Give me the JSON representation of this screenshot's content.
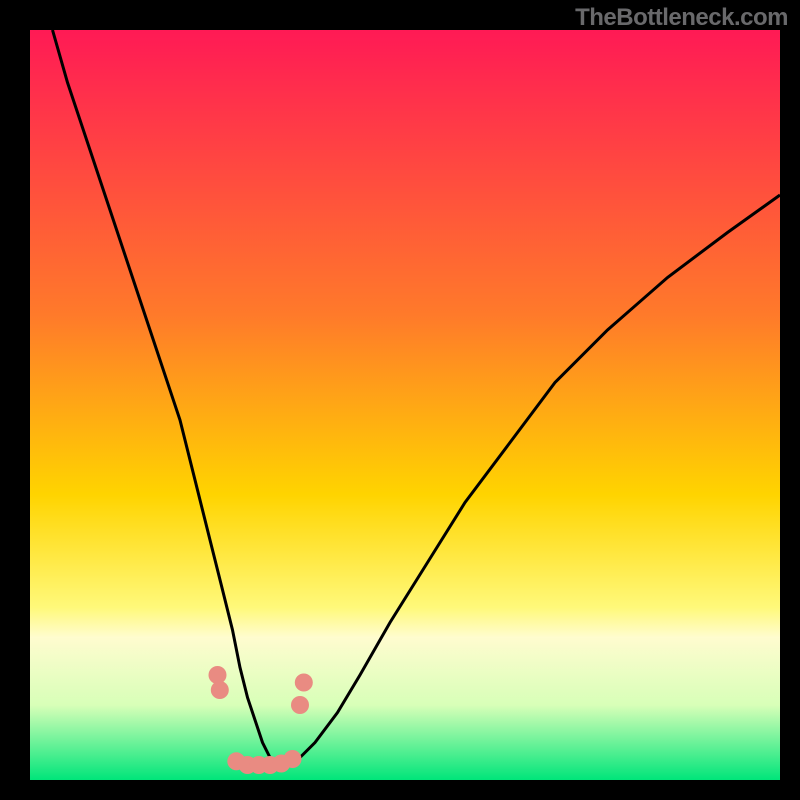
{
  "watermark": "TheBottleneck.com",
  "chart_data": {
    "type": "line",
    "title": "",
    "xlabel": "",
    "ylabel": "",
    "xlim": [
      0,
      100
    ],
    "ylim": [
      0,
      100
    ],
    "grid": false,
    "legend_position": "none",
    "background_gradient": {
      "top_color": "#ff1a55",
      "mid_color": "#ffd400",
      "bottom_color": "#00e57a",
      "lightband_y_fraction": 0.78
    },
    "series": [
      {
        "name": "black-curve",
        "type": "line",
        "color": "#000000",
        "x": [
          3,
          5,
          8,
          11,
          14,
          17,
          20,
          22,
          24,
          25.5,
          27,
          28,
          29,
          30,
          31,
          32,
          33,
          34.5,
          36,
          38,
          41,
          44,
          48,
          53,
          58,
          64,
          70,
          77,
          85,
          93,
          100
        ],
        "y": [
          100,
          93,
          84,
          75,
          66,
          57,
          48,
          40,
          32,
          26,
          20,
          15,
          11,
          8,
          5,
          3,
          2,
          2,
          3,
          5,
          9,
          14,
          21,
          29,
          37,
          45,
          53,
          60,
          67,
          73,
          78
        ]
      },
      {
        "name": "pink-markers",
        "type": "scatter",
        "color": "#e98b82",
        "radius": 9,
        "x": [
          25.0,
          25.3,
          27.5,
          29.0,
          30.5,
          32.0,
          33.5,
          35.0,
          36.0,
          36.5
        ],
        "y": [
          14,
          12,
          2.5,
          2.0,
          2.0,
          2.0,
          2.2,
          2.8,
          10,
          13
        ]
      }
    ]
  }
}
